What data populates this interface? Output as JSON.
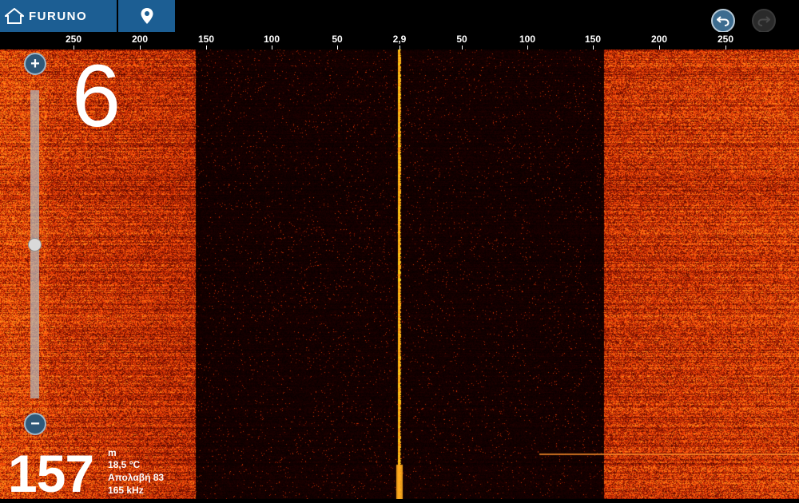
{
  "brand": {
    "name": "FURUNO",
    "home_icon": "home-icon"
  },
  "header": {
    "location_icon": "map-pin-icon",
    "undo_icon": "undo-icon",
    "redo_icon": "redo-icon"
  },
  "scale": {
    "labels": [
      "250",
      "200",
      "150",
      "100",
      "50",
      "2,9",
      "50",
      "100",
      "150",
      "200",
      "250"
    ]
  },
  "zoom": {
    "plus": "+",
    "minus": "−",
    "level": 0.5
  },
  "overlay": {
    "big_number": "6"
  },
  "readout": {
    "depth": "157",
    "unit": "m",
    "temperature": "18,5 °C",
    "gain": "Απολαβή 83",
    "frequency": "165 kHz"
  },
  "colors": {
    "accent": "#1c5e93",
    "echo_strong": "#ff6a1a",
    "echo_center": "#ffb020",
    "background": "#000000"
  }
}
